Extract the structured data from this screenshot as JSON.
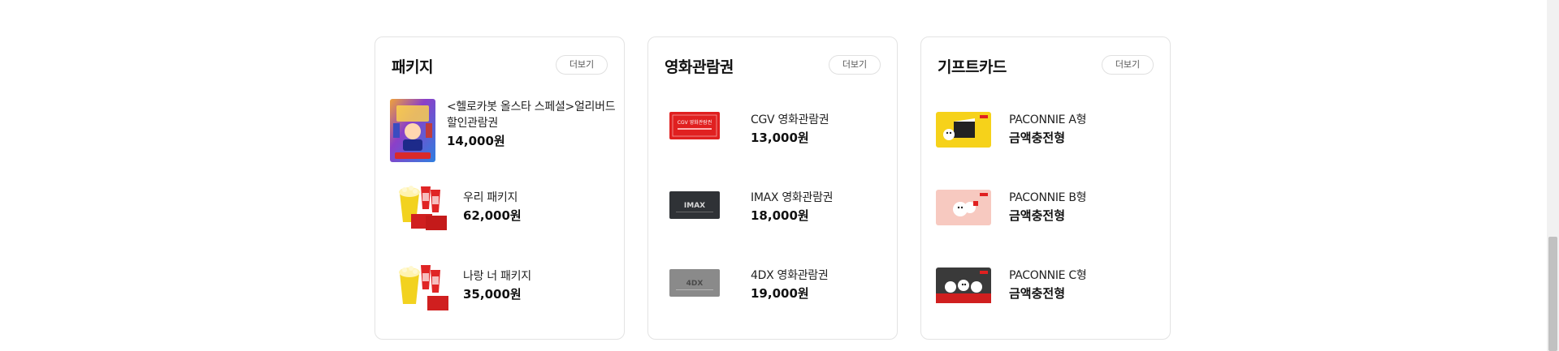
{
  "sections": [
    {
      "title": "패키지",
      "more_label": "더보기",
      "items": [
        {
          "name": "<헬로카봇 올스타 스페셜>얼리버드 할인관람권",
          "price": "14,000원"
        },
        {
          "name": "우리 패키지",
          "price": "62,000원"
        },
        {
          "name": "나랑 너 패키지",
          "price": "35,000원"
        }
      ]
    },
    {
      "title": "영화관람권",
      "more_label": "더보기",
      "items": [
        {
          "name": "CGV 영화관람권",
          "price": "13,000원",
          "thumb_text": "CGV 영화관람권"
        },
        {
          "name": "IMAX 영화관람권",
          "price": "18,000원",
          "thumb_text": "IMAX"
        },
        {
          "name": "4DX 영화관람권",
          "price": "19,000원",
          "thumb_text": "4DX"
        }
      ]
    },
    {
      "title": "기프트카드",
      "more_label": "더보기",
      "items": [
        {
          "name": "PACONNIE A형",
          "price": "금액충전형"
        },
        {
          "name": "PACONNIE B형",
          "price": "금액충전형"
        },
        {
          "name": "PACONNIE C형",
          "price": "금액충전형"
        }
      ]
    }
  ],
  "colors": {
    "cgv_red": "#e02020",
    "imax_dark": "#2f3236",
    "fourdx_gray": "#8a8a8a",
    "paconnie_a_yellow": "#f6d21a",
    "paconnie_b_pink": "#f7c9c0",
    "paconnie_c_dark": "#3a3a3a",
    "card_border": "#e3e3e3"
  }
}
